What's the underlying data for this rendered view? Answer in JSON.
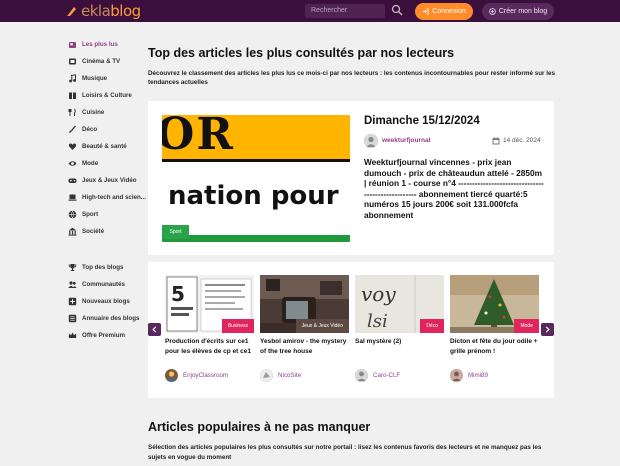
{
  "header": {
    "logo_text_a": "ekla",
    "logo_text_b": "blog",
    "search_placeholder": "Rechercher",
    "login_label": "Connexion",
    "create_label": "Créer mon blog"
  },
  "sidebar": {
    "categories": [
      {
        "label": "Les plus lus",
        "icon": "newspaper-icon"
      },
      {
        "label": "Cinéma & TV",
        "icon": "film-icon"
      },
      {
        "label": "Musique",
        "icon": "music-icon"
      },
      {
        "label": "Loisirs & Culture",
        "icon": "book-icon"
      },
      {
        "label": "Cuisine",
        "icon": "utensils-icon"
      },
      {
        "label": "Déco",
        "icon": "brush-icon"
      },
      {
        "label": "Beauté & santé",
        "icon": "heart-icon"
      },
      {
        "label": "Mode",
        "icon": "eye-icon"
      },
      {
        "label": "Jeux & Jeux Vidéo",
        "icon": "gamepad-icon"
      },
      {
        "label": "High-tech and scien...",
        "icon": "laptop-icon"
      },
      {
        "label": "Sport",
        "icon": "ball-icon"
      },
      {
        "label": "Société",
        "icon": "building-icon"
      }
    ],
    "links": [
      {
        "label": "Top des blogs",
        "icon": "trophy-icon"
      },
      {
        "label": "Communautés",
        "icon": "users-icon"
      },
      {
        "label": "Nouveaux blogs",
        "icon": "plus-square-icon"
      },
      {
        "label": "Annuaire des blogs",
        "icon": "list-icon"
      },
      {
        "label": "Offre Premium",
        "icon": "crown-icon"
      }
    ]
  },
  "main": {
    "title": "Top des articles les plus consultés par nos lecteurs",
    "description": "Découvrez le classement des articles les plus lus ce mois-ci par nos lecteurs : les contenus incontournables pour rester informé sur les tendances actuelles",
    "featured": {
      "image_text_1": "OR",
      "image_text_2": "nation pour",
      "category": "Sport",
      "title": "Dimanche 15/12/2024",
      "author": "weekturfjournal",
      "date": "14 déc. 2024",
      "text": "Weekturfjournal vincennes - prix jean dumouch - prix de châteaudun attelé - 2850m | réunion 1 - course n°4 -------------------------------------------------- abonnement tiercé quarté:5 numéros 15 jours 200€ soit 131.000fcfa abonnement"
    },
    "carousel": [
      {
        "category": "Business",
        "cat_color": "#e0245e",
        "title": "Production d'écrits sur ce1 pour les élèves de cp et ce1",
        "author": "EnjoyClassroom"
      },
      {
        "category": "Jeux & Jeux Vidéo",
        "cat_color": "#5e4a43",
        "title": "Yesbol amirov - the mystery of the tree house",
        "author": "NicoSite"
      },
      {
        "category": "Déco",
        "cat_color": "#e0245e",
        "title": "Sal mystère (2)",
        "author": "Caro-CLF"
      },
      {
        "category": "Mode",
        "cat_color": "#e0245e",
        "title": "Dicton et fête du jour odile + grille prénom !",
        "author": "Mimi89"
      }
    ],
    "section2_title": "Articles populaires à ne pas manquer",
    "section2_description": "Sélection des articles populaires les plus consultés sur notre portail : lisez les contenus favoris des lecteurs et ne manquez pas les sujets en vogue du moment"
  },
  "colors": {
    "header_bg": "#3a0f3c",
    "accent_orange": "#ff8c2b",
    "accent_purple": "#8e3f8b"
  }
}
